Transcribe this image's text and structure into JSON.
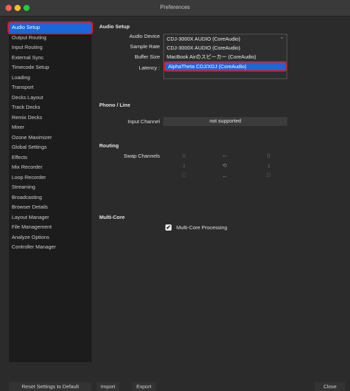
{
  "window": {
    "title": "Preferences"
  },
  "sidebar": {
    "items": [
      {
        "label": "Audio Setup"
      },
      {
        "label": "Output Routing"
      },
      {
        "label": "Input Routing"
      },
      {
        "label": "External Sync"
      },
      {
        "label": "Timecode Setup"
      },
      {
        "label": "Loading"
      },
      {
        "label": "Transport"
      },
      {
        "label": "Decks Layout"
      },
      {
        "label": "Track Decks"
      },
      {
        "label": "Remix Decks"
      },
      {
        "label": "Mixer"
      },
      {
        "label": "Ozone Maximizer"
      },
      {
        "label": "Global Settings"
      },
      {
        "label": "Effects"
      },
      {
        "label": "Mix Recorder"
      },
      {
        "label": "Loop Recorder"
      },
      {
        "label": "Streaming"
      },
      {
        "label": "Broadcasting"
      },
      {
        "label": "Browser Details"
      },
      {
        "label": "Layout Manager"
      },
      {
        "label": "File Management"
      },
      {
        "label": "Analyze Options"
      },
      {
        "label": "Controller Manager"
      }
    ]
  },
  "audio_setup": {
    "section_title": "Audio Setup",
    "audio_device_label": "Audio Device",
    "sample_rate_label": "Sample Rate",
    "buffer_size_label": "Buffer Size",
    "latency_label": "Latency :",
    "dropdown_options": [
      "CDJ-3000X AUDIO (CoreAudio)",
      "CDJ-3000X AUDIO (CoreAudio)",
      "MacBook Airのスピーカー (CoreAudio)",
      "AlphaTheta CDJ/XDJ (CoreAudio)"
    ]
  },
  "phono_line": {
    "section_title": "Phono / Line",
    "input_channel_label": "Input Channel",
    "input_channel_value": "not supported"
  },
  "routing": {
    "section_title": "Routing",
    "swap_channels_label": "Swap Channels",
    "a": "A",
    "b": "B",
    "c": "C",
    "d": "D"
  },
  "multicore": {
    "section_title": "Multi-Core",
    "checkbox_label": "Multi-Core Processing",
    "checked_mark": "✔"
  },
  "bottom": {
    "reset_label": "Reset Settings to Default",
    "import_label": "Import",
    "export_label": "Export",
    "close_label": "Close"
  }
}
